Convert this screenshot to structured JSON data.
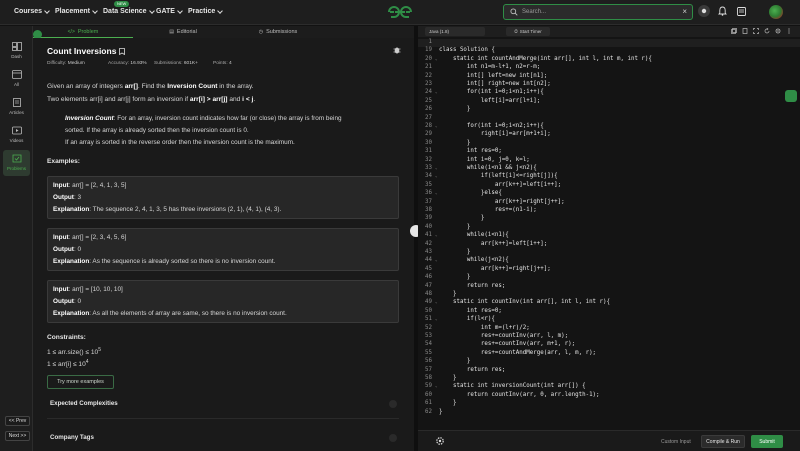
{
  "nav": {
    "items": [
      "Courses",
      "Placement",
      "Data Science",
      "GATE",
      "Practice"
    ],
    "new_badge": "NEW",
    "search_placeholder": "Search..."
  },
  "rail": {
    "items": [
      "Dash",
      "All",
      "Articles",
      "Videos",
      "Problems"
    ],
    "prev": "<< Prev",
    "next": "Next >>"
  },
  "tabs": [
    "Problem",
    "Editorial",
    "Submissions"
  ],
  "problem": {
    "title": "Count Inversions",
    "difficulty_label": "Difficulty:",
    "difficulty": "Medium",
    "accuracy_label": "Accuracy:",
    "accuracy": "16.93%",
    "submissions_label": "Submissions:",
    "submissions": "601K+",
    "points_label": "Points:",
    "points": "4",
    "desc1_a": "Given an array of integers ",
    "desc1_b": "arr[]",
    "desc1_c": ". Find the ",
    "desc1_d": "Inversion Count",
    "desc1_e": " in the array.",
    "desc2_a": "Two elements arr[i] and arr[j] form an inversion if ",
    "desc2_b": "arr[i] > arr[j]",
    "desc2_c": " and ",
    "desc2_d": "i < j",
    "desc2_e": ".",
    "note_label": "Inversion Count",
    "note1": ": For an array, inversion count indicates how far (or close) the array is from being",
    "note2": "sorted. If the array is already sorted then the inversion count is 0.",
    "note3": "If an array is sorted in the reverse order then the inversion count is the maximum.",
    "examples_heading": "Examples:",
    "input_label": "Input",
    "output_label": "Output",
    "explanation_label": "Explanation",
    "examples": [
      {
        "input": ": arr[] = [2, 4, 1, 3, 5]",
        "output": ": 3",
        "explanation": ": The sequence 2, 4, 1, 3, 5 has three inversions (2, 1), (4, 1), (4, 3)."
      },
      {
        "input": ": arr[] = [2, 3, 4, 5, 6]",
        "output": ": 0",
        "explanation": ": As the sequence is already sorted so there is no inversion count."
      },
      {
        "input": ": arr[] = [10, 10, 10]",
        "output": ": 0",
        "explanation": ": As all the elements of array are same, so there is no inversion count."
      }
    ],
    "constraints_heading": "Constraints:",
    "constraint1": "1 ≤ arr.size() ≤ 10",
    "constraint1_exp": "5",
    "constraint2": "1 ≤ arr[i] ≤ 10",
    "constraint2_exp": "4",
    "try_more": "Try more examples",
    "expected_complexities": "Expected Complexities",
    "company_tags": "Company Tags"
  },
  "editor": {
    "language": "Java (1.8)",
    "timer": "Start Timer",
    "lines": [
      {
        "n": "1",
        "code": ""
      },
      {
        "n": "19",
        "code": "class Solution {"
      },
      {
        "n": "20",
        "code": "    static int countAndMerge(int arr[], int l, int m, int r){"
      },
      {
        "n": "21",
        "code": "        int n1=m-l+1, n2=r-m;"
      },
      {
        "n": "22",
        "code": "        int[] left=new int[n1];"
      },
      {
        "n": "23",
        "code": "        int[] right=new int[n2];"
      },
      {
        "n": "24",
        "code": "        for(int i=0;i<n1;i++){"
      },
      {
        "n": "25",
        "code": "            left[i]=arr[l+i];"
      },
      {
        "n": "26",
        "code": "        }"
      },
      {
        "n": "27",
        "code": ""
      },
      {
        "n": "28",
        "code": "        for(int i=0;i<n2;i++){"
      },
      {
        "n": "29",
        "code": "            right[i]=arr[m+1+i];"
      },
      {
        "n": "30",
        "code": "        }"
      },
      {
        "n": "31",
        "code": "        int res=0;"
      },
      {
        "n": "32",
        "code": "        int i=0, j=0, k=l;"
      },
      {
        "n": "33",
        "code": "        while(i<n1 && j<n2){"
      },
      {
        "n": "34",
        "code": "            if(left[i]<=right[j]){"
      },
      {
        "n": "35",
        "code": "                arr[k++]=left[i++];"
      },
      {
        "n": "36",
        "code": "            }else{"
      },
      {
        "n": "37",
        "code": "                arr[k++]=right[j++];"
      },
      {
        "n": "38",
        "code": "                res+=(n1-i);"
      },
      {
        "n": "39",
        "code": "            }"
      },
      {
        "n": "40",
        "code": "        }"
      },
      {
        "n": "41",
        "code": "        while(i<n1){"
      },
      {
        "n": "42",
        "code": "            arr[k++]=left[i++];"
      },
      {
        "n": "43",
        "code": "        }"
      },
      {
        "n": "44",
        "code": "        while(j<n2){"
      },
      {
        "n": "45",
        "code": "            arr[k++]=right[j++];"
      },
      {
        "n": "46",
        "code": "        }"
      },
      {
        "n": "47",
        "code": "        return res;"
      },
      {
        "n": "48",
        "code": "    }"
      },
      {
        "n": "49",
        "code": "    static int countInv(int arr[], int l, int r){"
      },
      {
        "n": "50",
        "code": "        int res=0;"
      },
      {
        "n": "51",
        "code": "        if(l<r){"
      },
      {
        "n": "52",
        "code": "            int m=(l+r)/2;"
      },
      {
        "n": "53",
        "code": "            res+=countInv(arr, l, m);"
      },
      {
        "n": "54",
        "code": "            res+=countInv(arr, m+1, r);"
      },
      {
        "n": "55",
        "code": "            res+=countAndMerge(arr, l, m, r);"
      },
      {
        "n": "56",
        "code": "        }"
      },
      {
        "n": "57",
        "code": "        return res;"
      },
      {
        "n": "58",
        "code": "    }"
      },
      {
        "n": "59",
        "code": "    static int inversionCount(int arr[]) {"
      },
      {
        "n": "60",
        "code": "        return countInv(arr, 0, arr.length-1);"
      },
      {
        "n": "61",
        "code": "    }"
      },
      {
        "n": "62",
        "code": "}"
      }
    ],
    "custom_input": "Custom Input",
    "compile_run": "Compile & Run",
    "submit": "Submit"
  },
  "colors": {
    "accent": "#2f8d46",
    "bg": "#121212",
    "panel": "#1a1a1a"
  }
}
